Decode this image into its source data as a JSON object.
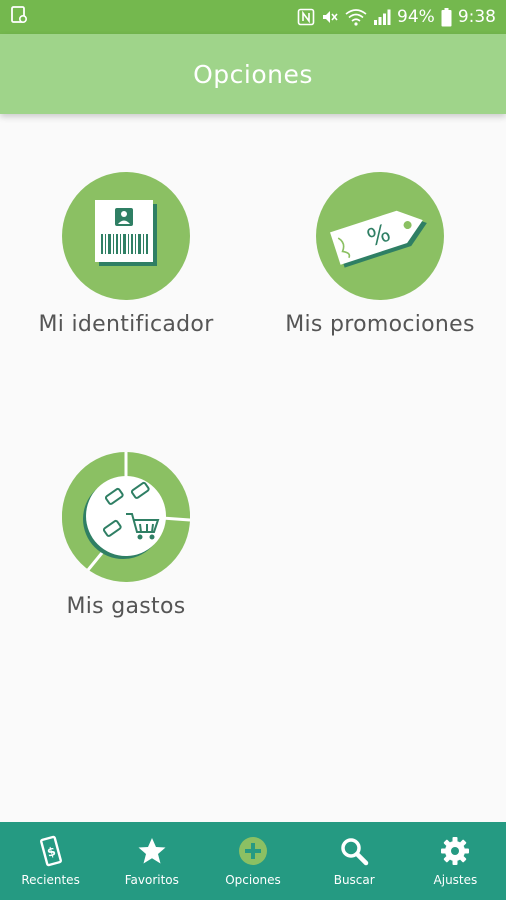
{
  "status_bar": {
    "battery": "94%",
    "time": "9:38",
    "icons": [
      "sim-card-icon",
      "nfc-icon",
      "mute-icon",
      "wifi-icon",
      "signal-icon",
      "battery-icon"
    ]
  },
  "header": {
    "title": "Opciones"
  },
  "options": [
    {
      "label": "Mi identificador",
      "icon": "id-card-barcode-icon"
    },
    {
      "label": "Mis promociones",
      "icon": "discount-tag-icon"
    },
    {
      "label": "Mis gastos",
      "icon": "spending-chart-icon"
    }
  ],
  "nav": {
    "items": [
      {
        "label": "Recientes",
        "icon": "receipt-icon"
      },
      {
        "label": "Favoritos",
        "icon": "star-icon"
      },
      {
        "label": "Opciones",
        "icon": "plus-circle-icon",
        "active": true
      },
      {
        "label": "Buscar",
        "icon": "search-icon"
      },
      {
        "label": "Ajustes",
        "icon": "gear-icon"
      }
    ]
  },
  "colors": {
    "status_bar": "#74b84e",
    "app_bar": "#9fd48a",
    "tile": "#8bc063",
    "nav": "#259a82",
    "active_nav_icon": "#8bc063"
  }
}
